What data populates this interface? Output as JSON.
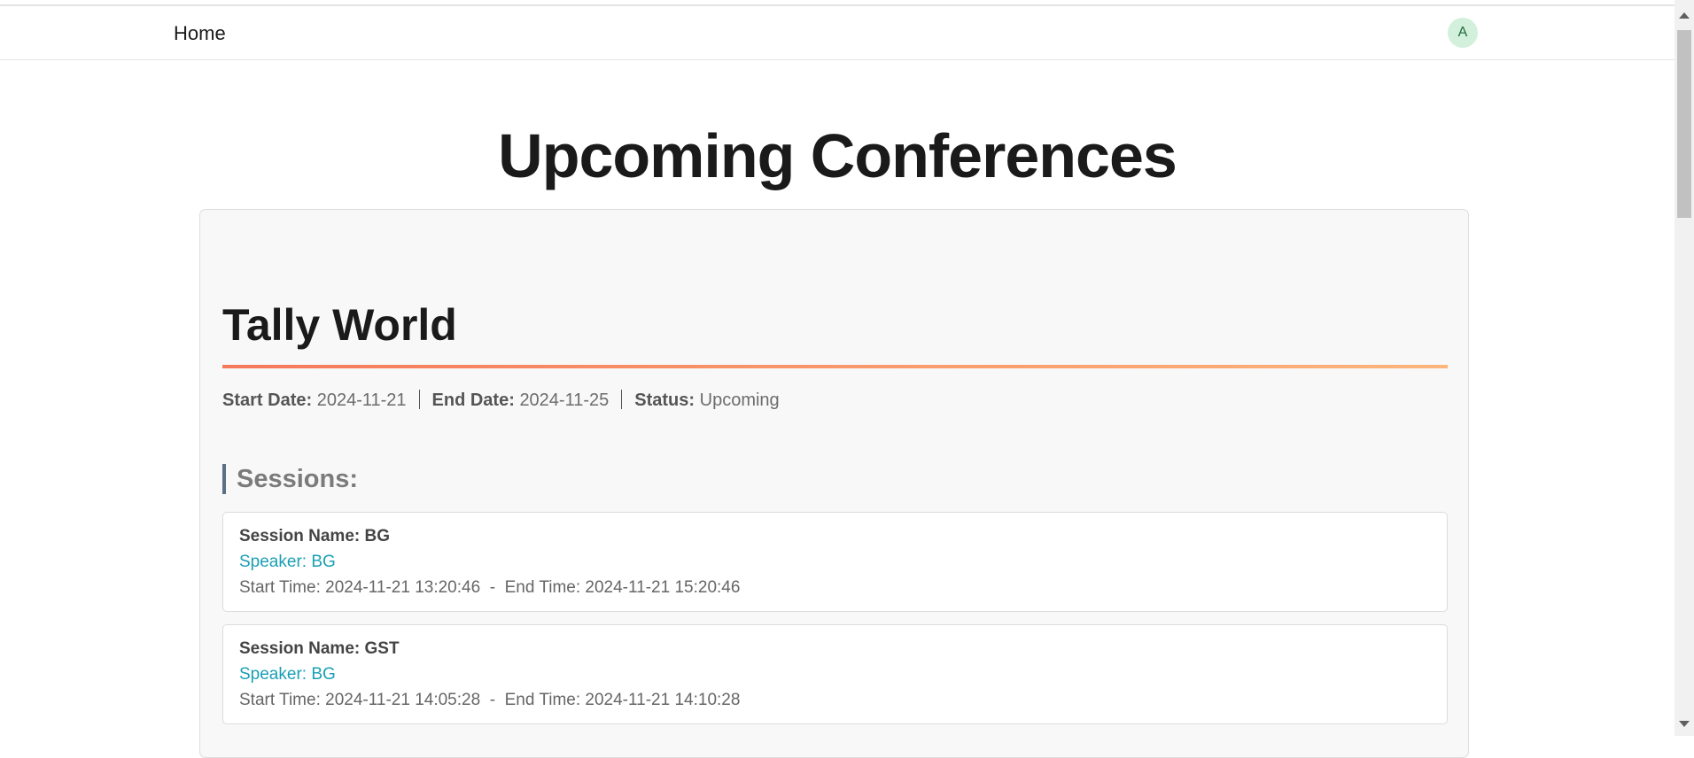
{
  "nav": {
    "home_label": "Home",
    "avatar_initial": "A"
  },
  "page": {
    "title": "Upcoming Conferences"
  },
  "conference": {
    "name": "Tally World",
    "start_label": "Start Date:",
    "start_date": "2024-11-21",
    "end_label": "End Date:",
    "end_date": "2024-11-25",
    "status_label": "Status:",
    "status": "Upcoming",
    "sessions_heading": "Sessions:",
    "sessions": [
      {
        "name": "Session Name: BG",
        "speaker": "Speaker: BG",
        "time": "Start Time: 2024-11-21 13:20:46  -  End Time: 2024-11-21 15:20:46"
      },
      {
        "name": "Session Name: GST",
        "speaker": "Speaker: BG",
        "time": "Start Time: 2024-11-21 14:05:28  -  End Time: 2024-11-21 14:10:28"
      }
    ]
  },
  "colors": {
    "accent_gradient_start": "#f57a5a",
    "accent_gradient_end": "#fdb57a",
    "speaker_color": "#1a9fb5",
    "avatar_bg": "#d3f0dc"
  }
}
